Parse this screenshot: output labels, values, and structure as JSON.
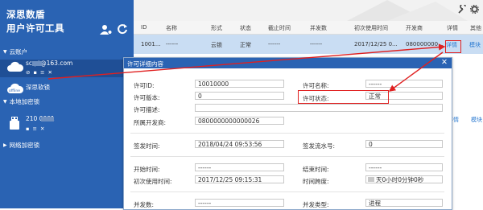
{
  "sidebar": {
    "title_line1": "深思数盾",
    "title_line2": "用户许可工具",
    "cloud_header": "云账户",
    "account_email": "sc    pt@163.com",
    "account_tools": "⊘ ▪ ≡ ✕",
    "offline_label": "深思软锁",
    "local_header": "本地加密锁",
    "device_id": "210     0001",
    "device_tools": "▪ ≡ ✕",
    "network_header": "网络加密锁"
  },
  "table": {
    "headers": [
      "ID",
      "名称",
      "形式",
      "状态",
      "截止时间",
      "并发数",
      "初次使用时间",
      "开发商",
      "详情",
      "其他"
    ],
    "row": [
      "1001...",
      "------",
      "云锁",
      "正常",
      "------",
      "------",
      "2017/12/25 0...",
      "080000000...",
      "详情",
      "模块"
    ]
  },
  "dialog": {
    "title": "许可详细内容",
    "close": "✕",
    "fields": {
      "license_id_label": "许可ID:",
      "license_id": "10010000",
      "license_name_label": "许可名称:",
      "license_name": "------",
      "license_version_label": "许可版本:",
      "license_version": "0",
      "license_status_label": "许可状态:",
      "license_status": "正常",
      "license_desc_label": "许可描述:",
      "license_desc": "",
      "developer_label": "所属开发商:",
      "developer": "0800000000000026",
      "issue_time_label": "签发时间:",
      "issue_time": "2018/04/24 09:53:56",
      "issue_serial_label": "签发流水号:",
      "issue_serial": "0",
      "start_time_label": "开始时间:",
      "start_time": "------",
      "end_time_label": "结束时间:",
      "end_time": "------",
      "first_use_label": "初次使用时间:",
      "first_use": "2017/12/25 09:15:31",
      "time_span_label": "时间跨度:",
      "time_span": "天0小时0分钟0秒",
      "concurrency_label": "并发数:",
      "concurrency": "------",
      "concurrency_type_label": "并发类型:",
      "concurrency_type": "进程"
    }
  },
  "colors": {
    "sidebar": "#2a63b3",
    "selected": "#c9ddf3",
    "highlight": "#e02020"
  },
  "icons": [
    "user-settings-icon",
    "refresh-icon",
    "cloud-icon",
    "offline-icon",
    "usb-key-icon",
    "wrench-icon",
    "gear-icon"
  ]
}
